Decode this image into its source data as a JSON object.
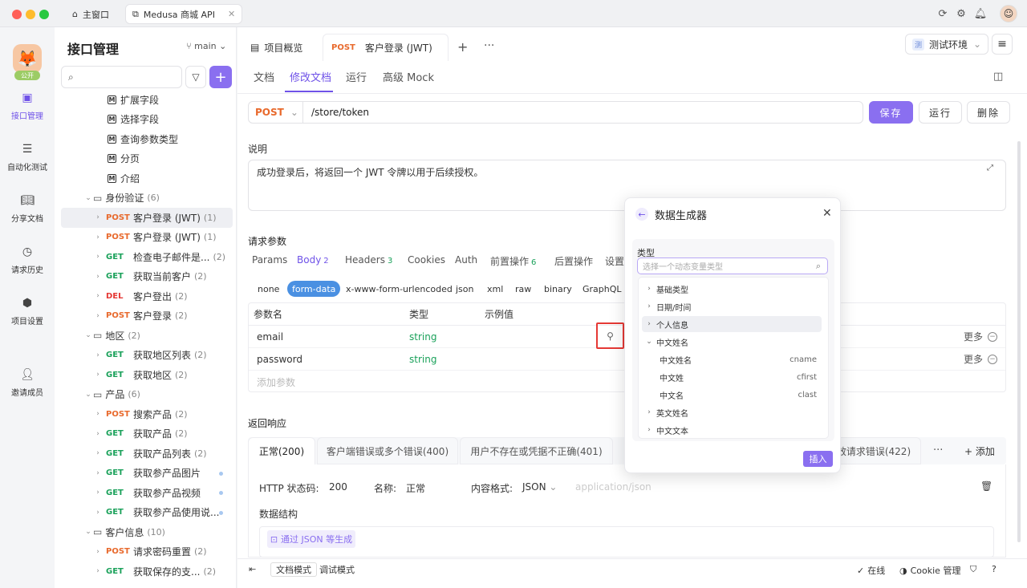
{
  "window": {
    "tabs": [
      {
        "label": "主窗口",
        "icon": "home-icon"
      },
      {
        "label": "Medusa 商城 API",
        "icon": "external-link-icon"
      }
    ],
    "top_icons": [
      "refresh-icon",
      "settings-icon",
      "bell-icon",
      "user-avatar"
    ]
  },
  "leftnav": {
    "project_badge": "公开",
    "items": [
      {
        "label": "接口管理",
        "icon": "api-icon"
      },
      {
        "label": "自动化测试",
        "icon": "layers-icon"
      },
      {
        "label": "分享文档",
        "icon": "book-icon"
      },
      {
        "label": "请求历史",
        "icon": "clock-icon"
      },
      {
        "label": "项目设置",
        "icon": "gear-icon"
      },
      {
        "label": "邀请成员",
        "icon": "add-user-icon"
      }
    ]
  },
  "sidebar": {
    "title": "接口管理",
    "branch": "main",
    "tree": [
      {
        "type": "doc",
        "label": "扩展字段",
        "indent": 2
      },
      {
        "type": "doc",
        "label": "选择字段",
        "indent": 2
      },
      {
        "type": "doc",
        "label": "查询参数类型",
        "indent": 2
      },
      {
        "type": "doc",
        "label": "分页",
        "indent": 2
      },
      {
        "type": "doc",
        "label": "介绍",
        "indent": 2
      },
      {
        "type": "folder",
        "label": "身份验证",
        "count": "(6)",
        "indent": 1
      },
      {
        "type": "api",
        "method": "POST",
        "label": "客户登录 (JWT)",
        "count": "(1)",
        "indent": 2,
        "selected": true
      },
      {
        "type": "api",
        "method": "POST",
        "label": "客户登录 (JWT)",
        "count": "(1)",
        "indent": 2
      },
      {
        "type": "api",
        "method": "GET",
        "label": "检查电子邮件是...",
        "count": "(2)",
        "indent": 2
      },
      {
        "type": "api",
        "method": "GET",
        "label": "获取当前客户",
        "count": "(2)",
        "indent": 2
      },
      {
        "type": "api",
        "method": "DEL",
        "label": "客户登出",
        "count": "(2)",
        "indent": 2
      },
      {
        "type": "api",
        "method": "POST",
        "label": "客户登录",
        "count": "(2)",
        "indent": 2
      },
      {
        "type": "folder",
        "label": "地区",
        "count": "(2)",
        "indent": 1
      },
      {
        "type": "api",
        "method": "GET",
        "label": "获取地区列表",
        "count": "(2)",
        "indent": 2
      },
      {
        "type": "api",
        "method": "GET",
        "label": "获取地区",
        "count": "(2)",
        "indent": 2
      },
      {
        "type": "folder",
        "label": "产品",
        "count": "(6)",
        "indent": 1
      },
      {
        "type": "api",
        "method": "POST",
        "label": "搜索产品",
        "count": "(2)",
        "indent": 2
      },
      {
        "type": "api",
        "method": "GET",
        "label": "获取产品",
        "count": "(2)",
        "indent": 2
      },
      {
        "type": "api",
        "method": "GET",
        "label": "获取产品列表",
        "count": "(2)",
        "indent": 2
      },
      {
        "type": "api",
        "method": "GET",
        "label": "获取参产品图片",
        "count": "",
        "indent": 2,
        "dot": true
      },
      {
        "type": "api",
        "method": "GET",
        "label": "获取参产品视频",
        "count": "",
        "indent": 2,
        "dot": true
      },
      {
        "type": "api",
        "method": "GET",
        "label": "获取参产品使用说...",
        "count": "",
        "indent": 2,
        "dot": true
      },
      {
        "type": "folder",
        "label": "客户信息",
        "count": "(10)",
        "indent": 1
      },
      {
        "type": "api",
        "method": "POST",
        "label": "请求密码重置",
        "count": "(2)",
        "indent": 2
      },
      {
        "type": "api",
        "method": "GET",
        "label": "获取保存的支...",
        "count": "(2)",
        "indent": 2
      }
    ]
  },
  "doc_tabs": {
    "overview": "项目概览",
    "active_method": "POST",
    "active_label": "客户登录 (JWT)",
    "env_badge": "测",
    "env": "测试环境"
  },
  "subtabs": [
    "文档",
    "修改文档",
    "运行",
    "高级 Mock"
  ],
  "request": {
    "method": "POST",
    "path": "/store/token",
    "save": "保存",
    "run": "运行",
    "delete": "删除",
    "desc_label": "说明",
    "desc": "成功登录后，将返回一个 JWT 令牌以用于后续授权。"
  },
  "params": {
    "section": "请求参数",
    "tabs": [
      {
        "label": "Params",
        "n": ""
      },
      {
        "label": "Body",
        "n": "2"
      },
      {
        "label": "Headers",
        "n": "3"
      },
      {
        "label": "Cookies",
        "n": ""
      },
      {
        "label": "Auth",
        "n": ""
      },
      {
        "label": "前置操作",
        "n": "6"
      },
      {
        "label": "后置操作",
        "n": ""
      },
      {
        "label": "设置",
        "n": ""
      }
    ],
    "body_types": [
      "none",
      "form-data",
      "x-www-form-urlencoded",
      "json",
      "xml",
      "raw",
      "binary",
      "GraphQL"
    ],
    "headers": {
      "name": "参数名",
      "type": "类型",
      "example": "示例值"
    },
    "rows": [
      {
        "name": "email",
        "type": "string",
        "more": "更多"
      },
      {
        "name": "password",
        "type": "string",
        "more": "更多"
      }
    ],
    "add_placeholder": "添加参数"
  },
  "response": {
    "section": "返回响应",
    "tabs": [
      "正常(200)",
      "客户端错误或多个错误(400)",
      "用户不存在或凭据不正确(401)",
      "效请求错误(422)"
    ],
    "add": "添加",
    "status_label": "HTTP 状态码:",
    "status": "200",
    "name_label": "名称:",
    "name": "正常",
    "format_label": "内容格式:",
    "format": "JSON",
    "content_type": "application/json",
    "struct_label": "数据结构",
    "json_gen": "通过 JSON 等生成"
  },
  "bottom": {
    "doc_mode": "文档模式",
    "debug_mode": "调试模式",
    "online": "在线",
    "cookie": "Cookie 管理"
  },
  "popup": {
    "title": "数据生成器",
    "type_label": "类型",
    "placeholder": "选择一个动态变量类型",
    "items": [
      {
        "label": "基础类型",
        "chev": "›",
        "code": "",
        "sub": false
      },
      {
        "label": "日期/时间",
        "chev": "›",
        "code": "",
        "sub": false
      },
      {
        "label": "个人信息",
        "chev": "›",
        "code": "",
        "sub": false,
        "hl": true
      },
      {
        "label": "中文姓名",
        "chev": "⌄",
        "code": "",
        "sub": false
      },
      {
        "label": "中文姓名",
        "chev": "",
        "code": "cname",
        "sub": true
      },
      {
        "label": "中文姓",
        "chev": "",
        "code": "cfirst",
        "sub": true
      },
      {
        "label": "中文名",
        "chev": "",
        "code": "clast",
        "sub": true
      },
      {
        "label": "英文姓名",
        "chev": "›",
        "code": "",
        "sub": false
      },
      {
        "label": "中文文本",
        "chev": "›",
        "code": "",
        "sub": false
      }
    ],
    "insert": "插入"
  }
}
